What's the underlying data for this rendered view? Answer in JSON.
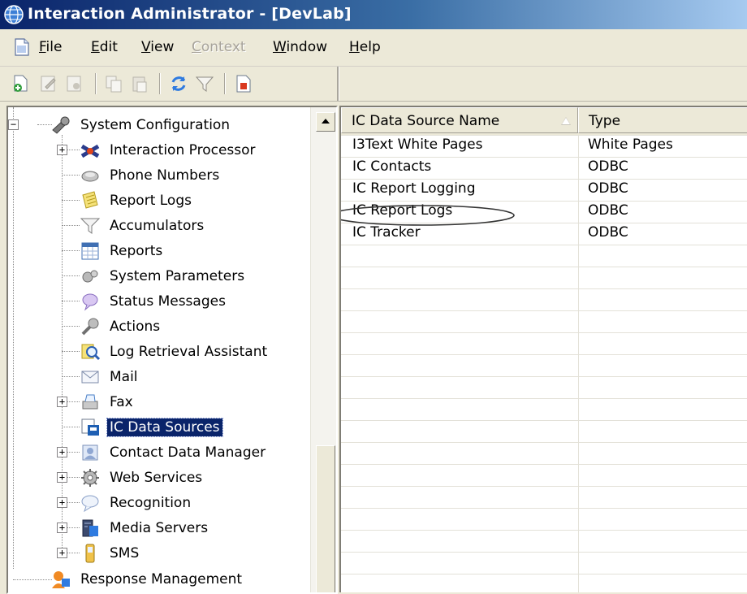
{
  "window": {
    "title": "Interaction Administrator - [DevLab]"
  },
  "menu": {
    "items": [
      {
        "label": "File",
        "accel": "F",
        "rest": "ile",
        "disabled": false
      },
      {
        "label": "Edit",
        "accel": "E",
        "rest": "dit",
        "disabled": false
      },
      {
        "label": "View",
        "accel": "V",
        "rest": "iew",
        "disabled": false
      },
      {
        "label": "Context",
        "accel": "C",
        "rest": "ontext",
        "disabled": true
      },
      {
        "label": "Window",
        "accel": "W",
        "rest": "indow",
        "disabled": false
      },
      {
        "label": "Help",
        "accel": "H",
        "rest": "elp",
        "disabled": false
      }
    ]
  },
  "toolbar": {
    "buttons": [
      "new-icon",
      "edit-icon",
      "properties-icon",
      "copy-icon",
      "paste-icon",
      "refresh-icon",
      "filter-icon",
      "report-icon"
    ]
  },
  "tree": {
    "root_label": "System Configuration",
    "items": [
      {
        "label": "Interaction Processor",
        "icon": "interaction-processor-icon",
        "expandable": true
      },
      {
        "label": "Phone Numbers",
        "icon": "phone-numbers-icon",
        "expandable": false
      },
      {
        "label": "Report Logs",
        "icon": "report-logs-icon",
        "expandable": false
      },
      {
        "label": "Accumulators",
        "icon": "accumulators-icon",
        "expandable": false
      },
      {
        "label": "Reports",
        "icon": "reports-icon",
        "expandable": false
      },
      {
        "label": "System Parameters",
        "icon": "system-parameters-icon",
        "expandable": false
      },
      {
        "label": "Status Messages",
        "icon": "status-messages-icon",
        "expandable": false
      },
      {
        "label": "Actions",
        "icon": "actions-icon",
        "expandable": false
      },
      {
        "label": "Log Retrieval Assistant",
        "icon": "log-retrieval-icon",
        "expandable": false
      },
      {
        "label": "Mail",
        "icon": "mail-icon",
        "expandable": false
      },
      {
        "label": "Fax",
        "icon": "fax-icon",
        "expandable": true
      },
      {
        "label": "IC Data Sources",
        "icon": "data-sources-icon",
        "expandable": false,
        "selected": true
      },
      {
        "label": "Contact Data Manager",
        "icon": "contact-data-icon",
        "expandable": true
      },
      {
        "label": "Web Services",
        "icon": "web-services-icon",
        "expandable": true
      },
      {
        "label": "Recognition",
        "icon": "recognition-icon",
        "expandable": true
      },
      {
        "label": "Media Servers",
        "icon": "media-servers-icon",
        "expandable": true
      },
      {
        "label": "SMS",
        "icon": "sms-icon",
        "expandable": true
      }
    ],
    "sibling_label": "Response Management"
  },
  "list": {
    "columns": [
      "IC Data Source Name",
      "Type"
    ],
    "rows": [
      {
        "name": "I3Text White Pages",
        "type": "White Pages"
      },
      {
        "name": "IC Contacts",
        "type": "ODBC"
      },
      {
        "name": "IC Report Logging",
        "type": "ODBC"
      },
      {
        "name": "IC Report Logs",
        "type": "ODBC",
        "annotated": true
      },
      {
        "name": "IC Tracker",
        "type": "ODBC"
      }
    ]
  },
  "colors": {
    "title_start": "#0a246a",
    "title_end": "#a6caf0",
    "selection": "#0a246a",
    "chrome": "#ece9d8"
  }
}
